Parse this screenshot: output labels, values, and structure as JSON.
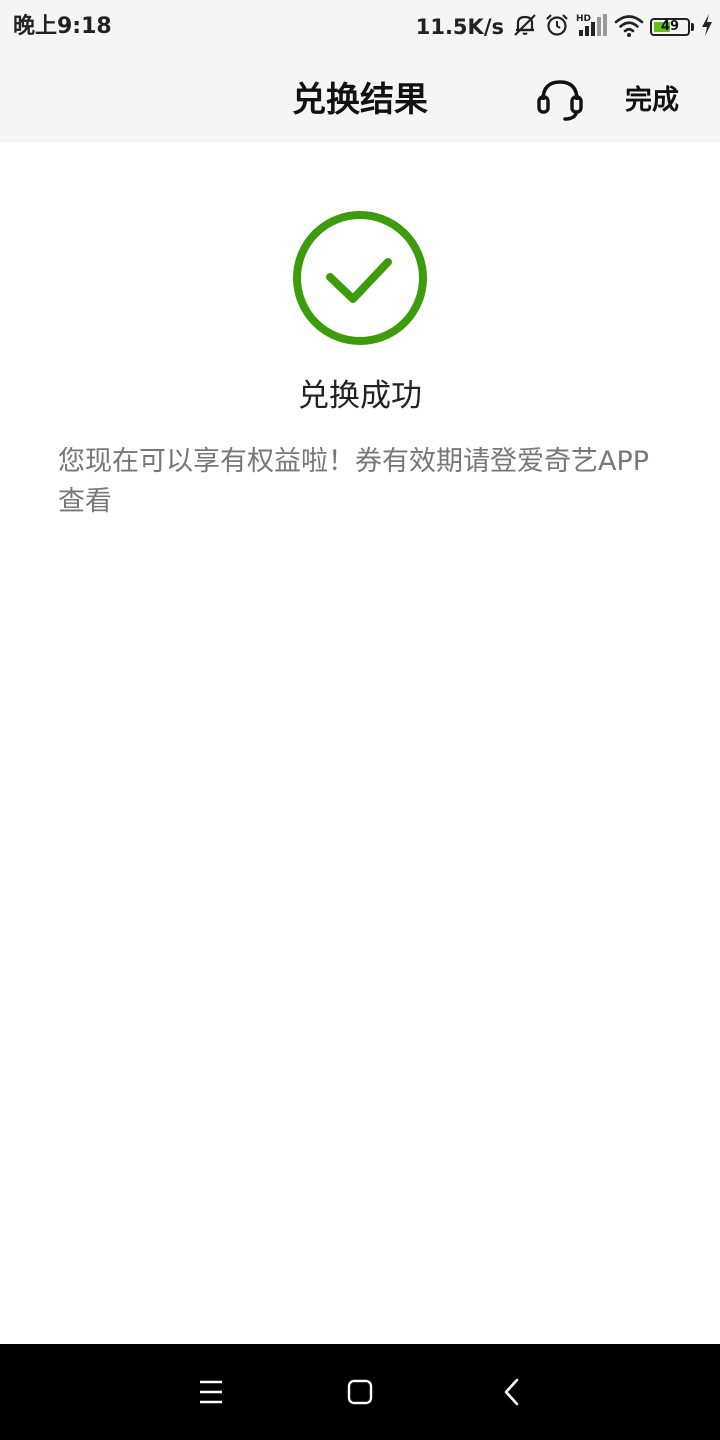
{
  "status_bar": {
    "time": "晚上9:18",
    "net_speed": "11.5K/s",
    "battery_level": "49",
    "battery_percent": 49,
    "icons": [
      "mute-icon",
      "alarm-icon",
      "hd-signal-icon",
      "wifi-icon",
      "battery-icon",
      "charging-icon"
    ]
  },
  "header": {
    "title": "兑换结果",
    "support_icon": "headset-icon",
    "done_label": "完成"
  },
  "result": {
    "icon": "check-circle-icon",
    "title": "兑换成功",
    "description": "您现在可以享有权益啦！券有效期请登爱奇艺APP查看"
  },
  "nav_bar": {
    "icons": [
      "menu-icon",
      "home-icon",
      "back-icon"
    ]
  },
  "colors": {
    "success_green": "#3c9c0c",
    "battery_green": "#5fc11a",
    "header_bg": "#f5f5f5",
    "description_text": "#777777"
  }
}
